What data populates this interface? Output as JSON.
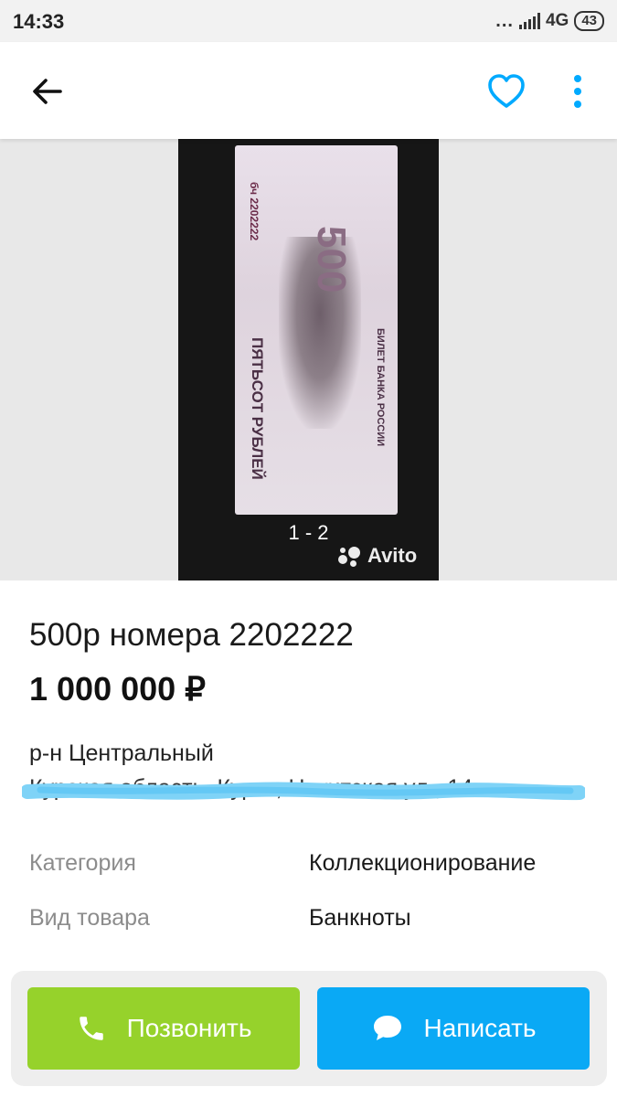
{
  "status_bar": {
    "time": "14:33",
    "more": "...",
    "network": "4G",
    "battery": "43"
  },
  "toolbar": {
    "back_icon": "arrow-left-icon",
    "favorite_icon": "heart-icon",
    "more_icon": "more-vertical-icon",
    "accent_color": "#00AAFF"
  },
  "gallery": {
    "counter": "1 - 2",
    "watermark": "Avito",
    "photo_text": {
      "denomination": "500",
      "serial": "бч 2202222",
      "bank": "БИЛЕТ БАНКА РОССИИ",
      "words": "ПЯТЬСОТ РУБЛЕЙ"
    }
  },
  "listing": {
    "title": "500р номера 2202222",
    "price": "1 000 000 ₽",
    "district": "р-н Центральный",
    "address": "Курская область, Курск, Никитская ул., 14"
  },
  "specs": [
    {
      "label": "Категория",
      "value": "Коллекционирование"
    },
    {
      "label": "Вид товара",
      "value": "Банкноты"
    }
  ],
  "actions": {
    "call_label": "Позвонить",
    "call_color": "#96D22B",
    "message_label": "Написать",
    "message_color": "#0AA9F5"
  }
}
